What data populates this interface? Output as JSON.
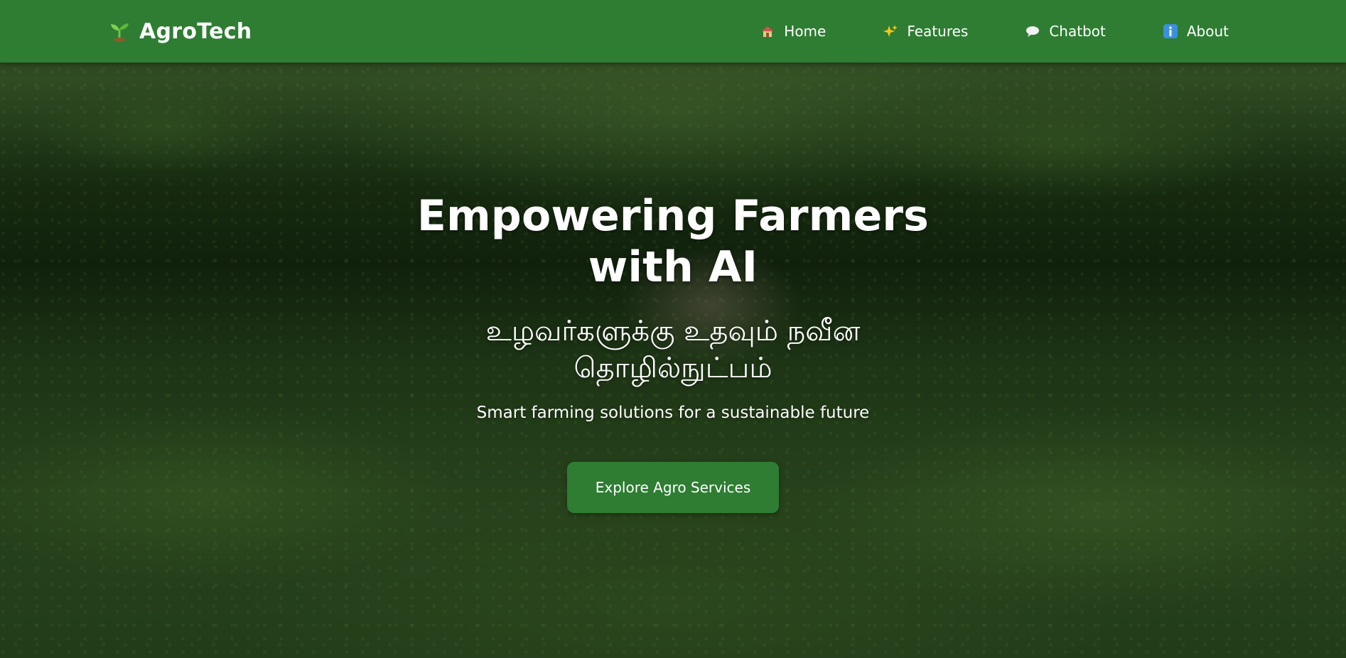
{
  "navbar": {
    "brand": {
      "name": "AgroTech",
      "icon": "seedling-icon"
    },
    "links": [
      {
        "label": "Home",
        "icon": "house-icon"
      },
      {
        "label": "Features",
        "icon": "sparkles-icon"
      },
      {
        "label": "Chatbot",
        "icon": "speech-bubble-icon"
      },
      {
        "label": "About",
        "icon": "info-icon"
      }
    ],
    "background_color": "#2e7d32"
  },
  "hero": {
    "title": "Empowering Farmers with AI",
    "tamil_subtitle": "உழவர்களுக்கு உதவும் நவீன தொழில்நுட்பம்",
    "subtitle": "Smart farming solutions for a sustainable future",
    "cta_label": "Explore Agro Services",
    "cta_color": "#2e7d32"
  }
}
